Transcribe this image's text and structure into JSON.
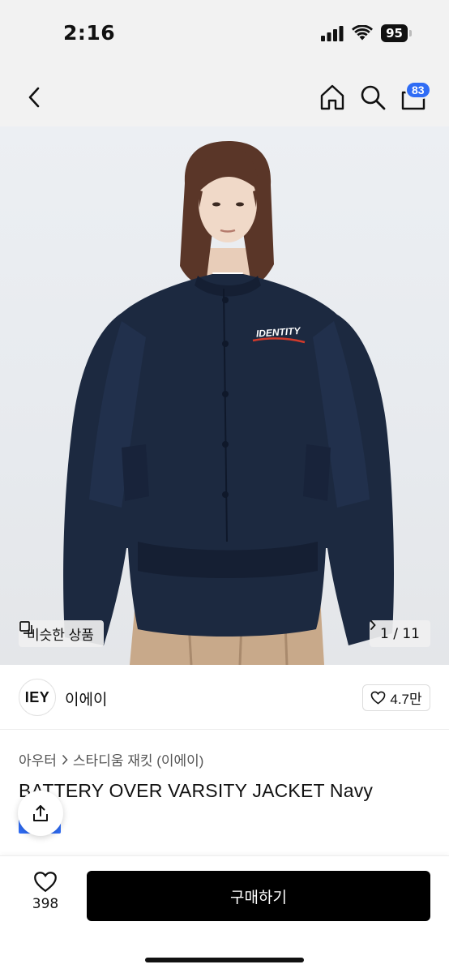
{
  "status": {
    "time": "2:16",
    "battery": "95"
  },
  "header": {
    "cart_count": "83"
  },
  "hero": {
    "logo_text": "IDENTITY",
    "similar_label": "비슷한 상품",
    "pager_text": "1 / 11"
  },
  "brand": {
    "logo": "IEY",
    "name": "이에이",
    "likes": "4.7만"
  },
  "product": {
    "category": "아우터",
    "subcategory": "스타디움 재킷 (이에이)",
    "title": "BATTERY OVER VARSITY JACKET Navy"
  },
  "bottom": {
    "wish_count": "398",
    "buy_label": "구매하기"
  },
  "colors": {
    "accent": "#2f6cf5",
    "buy_button": "#000000",
    "jacket": "#1c2940",
    "pants": "#c8a98a"
  },
  "icons": [
    "back-icon",
    "home-icon",
    "search-icon",
    "cart-icon",
    "similar-icon",
    "chevron-right-icon",
    "heart-icon",
    "share-icon"
  ]
}
